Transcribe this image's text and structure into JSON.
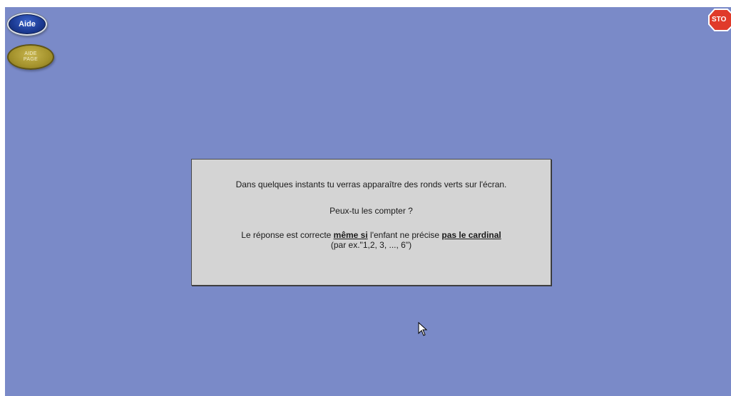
{
  "toolbar": {
    "help_label": "Aide",
    "help_page_label": "AIDE\nPAGE",
    "stop_label": "STO"
  },
  "dialog": {
    "line1": "Dans quelques instants tu verras apparaître des ronds verts sur l'écran.",
    "line2": "Peux-tu les compter ?",
    "line3_part1": "Le réponse est correcte ",
    "line3_em1": "même si",
    "line3_part2": " l'enfant ne précise ",
    "line3_em2": "pas le cardinal",
    "line3_part3": "(par ex.\"1,2, 3, ..., 6\")"
  },
  "colors": {
    "background": "#7a8ac8",
    "dialog_bg": "#d4d4d4",
    "help_button": "#1c3b94",
    "help_page_button": "#a4922c",
    "stop_sign": "#e03a2a"
  },
  "icons": {
    "stop": "stop-sign-icon",
    "cursor": "mouse-pointer-icon"
  }
}
